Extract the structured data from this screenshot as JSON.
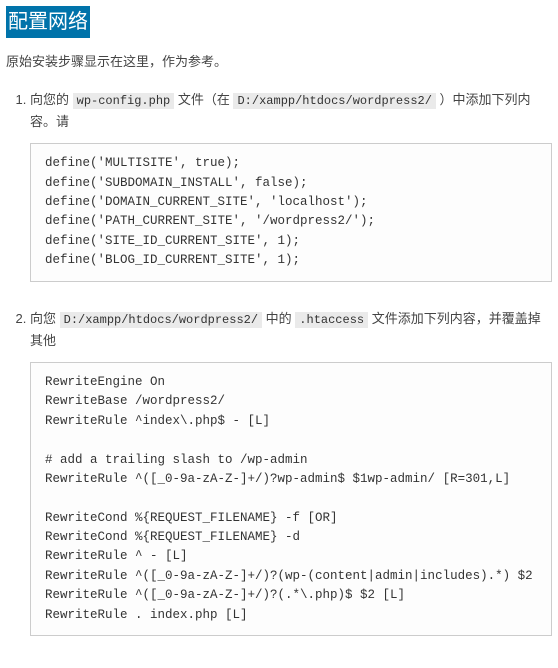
{
  "heading": "配置网络",
  "intro": "原始安装步骤显示在这里，作为参考。",
  "step1": {
    "prefix": "向您的 ",
    "code1": "wp-config.php",
    "mid1": " 文件（在 ",
    "code2": "D:/xampp/htdocs/wordpress2/",
    "suffix": " ）中添加下列内容。请",
    "block": "define('MULTISITE', true);\ndefine('SUBDOMAIN_INSTALL', false);\ndefine('DOMAIN_CURRENT_SITE', 'localhost');\ndefine('PATH_CURRENT_SITE', '/wordpress2/');\ndefine('SITE_ID_CURRENT_SITE', 1);\ndefine('BLOG_ID_CURRENT_SITE', 1);"
  },
  "step2": {
    "prefix": "向您 ",
    "code1": "D:/xampp/htdocs/wordpress2/",
    "mid1": " 中的 ",
    "code2": ".htaccess",
    "suffix": " 文件添加下列内容，并覆盖掉其他",
    "block": "RewriteEngine On\nRewriteBase /wordpress2/\nRewriteRule ^index\\.php$ - [L]\n\n# add a trailing slash to /wp-admin\nRewriteRule ^([_0-9a-zA-Z-]+/)?wp-admin$ $1wp-admin/ [R=301,L]\n\nRewriteCond %{REQUEST_FILENAME} -f [OR]\nRewriteCond %{REQUEST_FILENAME} -d\nRewriteRule ^ - [L]\nRewriteRule ^([_0-9a-zA-Z-]+/)?(wp-(content|admin|includes).*) $2\nRewriteRule ^([_0-9a-zA-Z-]+/)?(.*\\.php)$ $2 [L]\nRewriteRule . index.php [L]"
  }
}
